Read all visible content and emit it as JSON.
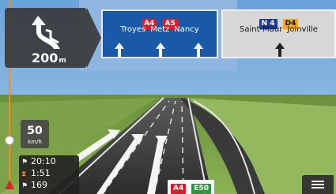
{
  "maneuver": {
    "distance": "200",
    "distance_unit": "m",
    "icon": "keep-left-arrow-icon"
  },
  "signpost": {
    "main": {
      "shields": [
        "A4",
        "A5"
      ],
      "destinations": [
        "Troyes",
        "Metz",
        "Nancy"
      ],
      "color": "#1a59a8"
    },
    "side": {
      "shields": [
        "N 4",
        "D4"
      ],
      "destinations": [
        "Saint-Maur",
        "Joinville"
      ],
      "color": "#d7d7d7"
    }
  },
  "speed_limit": {
    "value": "50",
    "unit": "km/h"
  },
  "trip": {
    "arrival_time": "20:10",
    "remaining_time": "1:51",
    "remaining_distance": "169"
  },
  "current_road": {
    "shields": [
      "A4",
      "E50"
    ]
  },
  "colors": {
    "route_progress": "#f28c1e",
    "shield_red": "#d81e2a",
    "shield_green": "#2c9a3a"
  },
  "menu": {
    "icon": "menu-icon"
  }
}
